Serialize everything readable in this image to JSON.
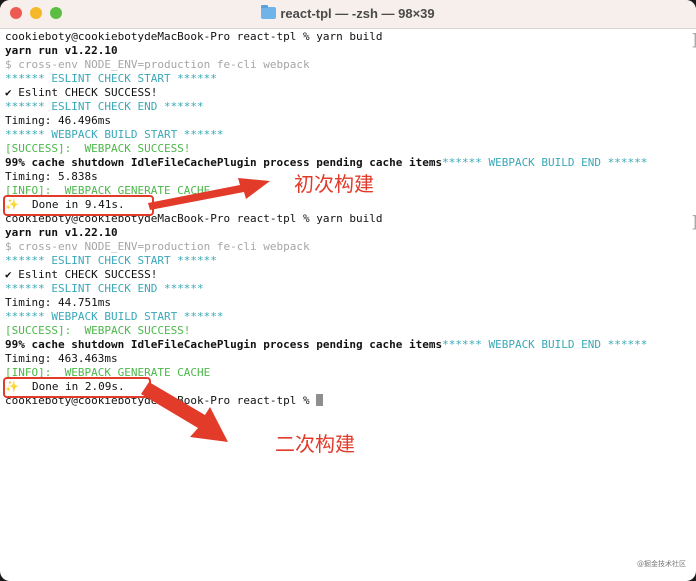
{
  "window": {
    "title": "react-tpl — -zsh — 98×39",
    "folder_icon": "folder-icon",
    "traffic_lights": [
      "close",
      "minimize",
      "zoom"
    ]
  },
  "terminal": {
    "run1": {
      "prompt": "cookieboty@cookiebotydeMacBook-Pro react-tpl % yarn build",
      "yarn_version": "yarn run v1.22.10",
      "command": "$ cross-env NODE_ENV=production fe-cli webpack",
      "eslint_start": "****** ESLINT CHECK START ******",
      "eslint_success": "✔ Eslint CHECK SUCCESS!",
      "eslint_end": "****** ESLINT CHECK END ******",
      "timing1": "Timing: 46.496ms",
      "webpack_start": "****** WEBPACK BUILD START ******",
      "webpack_success": "[SUCCESS]:  WEBPACK SUCCESS!",
      "cache_line": "99% cache shutdown IdleFileCachePlugin process pending cache items",
      "webpack_end": "****** WEBPACK BUILD END ******",
      "timing2": "Timing: 5.838s",
      "info": "[INFO]:  WEBPACK GENERATE CACHE",
      "done_icon": "✨",
      "done": "  Done in 9.41s."
    },
    "run2": {
      "prompt": "cookieboty@cookiebotydeMacBook-Pro react-tpl % yarn build",
      "yarn_version": "yarn run v1.22.10",
      "command": "$ cross-env NODE_ENV=production fe-cli webpack",
      "eslint_start": "****** ESLINT CHECK START ******",
      "eslint_success": "✔ Eslint CHECK SUCCESS!",
      "eslint_end": "****** ESLINT CHECK END ******",
      "timing1": "Timing: 44.751ms",
      "webpack_start": "****** WEBPACK BUILD START ******",
      "webpack_success": "[SUCCESS]:  WEBPACK SUCCESS!",
      "cache_line": "99% cache shutdown IdleFileCachePlugin process pending cache items",
      "webpack_end": "****** WEBPACK BUILD END ******",
      "timing2": "Timing: 463.463ms",
      "info": "[INFO]:  WEBPACK GENERATE CACHE",
      "done_icon": "✨",
      "done": "  Done in 2.09s."
    },
    "final_prompt": "cookieboty@cookiebotydeMacBook-Pro react-tpl % "
  },
  "annotations": {
    "first_build": "初次构建",
    "second_build": "二次构建",
    "color": "#e23b2a"
  },
  "watermark": "@掘金技术社区"
}
